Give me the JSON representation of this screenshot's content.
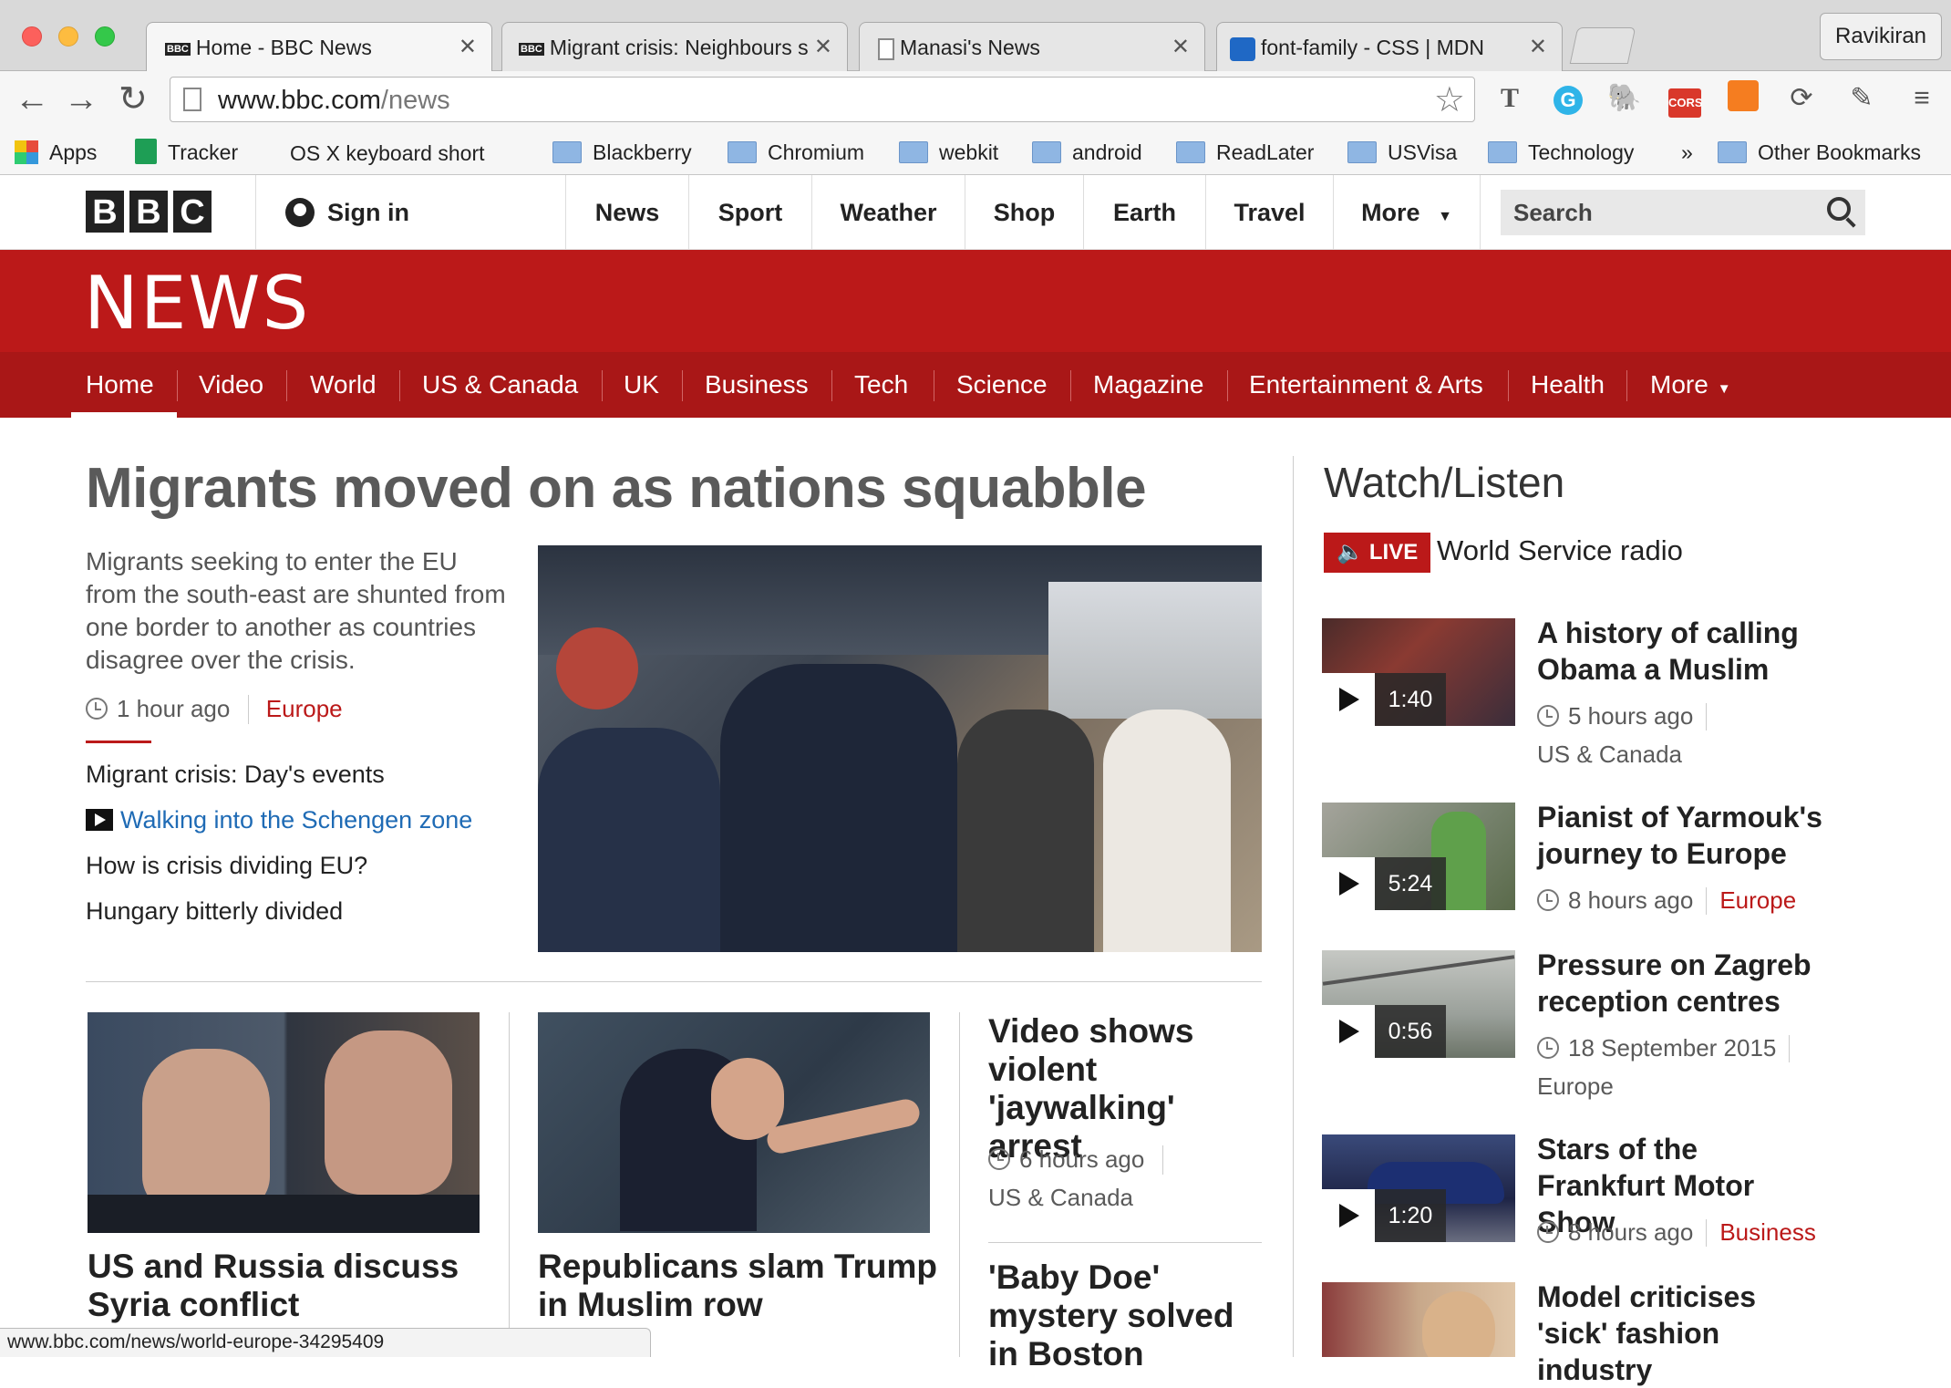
{
  "browser": {
    "tabs": [
      {
        "title": "Home - BBC News",
        "favicon": "BBC"
      },
      {
        "title": "Migrant crisis: Neighbours sq",
        "favicon": "BBC"
      },
      {
        "title": "Manasi's News",
        "favicon": ""
      },
      {
        "title": "font-family - CSS | MDN",
        "favicon": ""
      }
    ],
    "profile": "Ravikiran",
    "url_domain": "www.bbc.com",
    "url_path": "/news",
    "bookmarks": [
      "Apps",
      "Tracker",
      "OS X keyboard short",
      "Blackberry",
      "Chromium",
      "webkit",
      "android",
      "ReadLater",
      "USVisa",
      "Technology",
      "»",
      "Other Bookmarks"
    ],
    "status_url": "www.bbc.com/news/world-europe-34295409"
  },
  "bbc": {
    "logo": [
      "B",
      "B",
      "C"
    ],
    "sign_in": "Sign in",
    "nav": [
      "News",
      "Sport",
      "Weather",
      "Shop",
      "Earth",
      "Travel",
      "More"
    ],
    "search_placeholder": "Search"
  },
  "news": {
    "brand": "NEWS",
    "subnav": [
      "Home",
      "Video",
      "World",
      "US & Canada",
      "UK",
      "Business",
      "Tech",
      "Science",
      "Magazine",
      "Entertainment & Arts",
      "Health",
      "More"
    ]
  },
  "top_story": {
    "headline": "Migrants moved on as nations squabble",
    "summary": "Migrants seeking to enter the EU from the south-east are shunted from one border to another as countries disagree over the crisis.",
    "time": "1 hour ago",
    "section": "Europe",
    "related": [
      "Migrant crisis: Day's events",
      "Walking into the Schengen zone",
      "How is crisis dividing EU?",
      "Hungary bitterly divided"
    ]
  },
  "secondary": [
    {
      "headline": "US and Russia discuss Syria conflict"
    },
    {
      "headline": "Republicans slam Trump in Muslim row"
    },
    {
      "headline": "Video shows violent 'jaywalking' arrest",
      "time": "6 hours ago",
      "section": "US & Canada"
    },
    {
      "headline": "'Baby Doe' mystery solved in Boston"
    }
  ],
  "watch": {
    "title": "Watch/Listen",
    "live": "LIVE",
    "live_text": "World Service radio",
    "items": [
      {
        "title": "A history of calling Obama a Muslim",
        "duration": "1:40",
        "time": "5 hours ago",
        "section": "US & Canada"
      },
      {
        "title": "Pianist of Yarmouk's journey to Europe",
        "duration": "5:24",
        "time": "8 hours ago",
        "section": "Europe"
      },
      {
        "title": "Pressure on Zagreb reception centres",
        "duration": "0:56",
        "time": "18 September 2015",
        "section": "Europe"
      },
      {
        "title": "Stars of the Frankfurt Motor Show",
        "duration": "1:20",
        "time": "8 hours ago",
        "section": "Business"
      },
      {
        "title": "Model criticises 'sick' fashion industry"
      }
    ]
  }
}
